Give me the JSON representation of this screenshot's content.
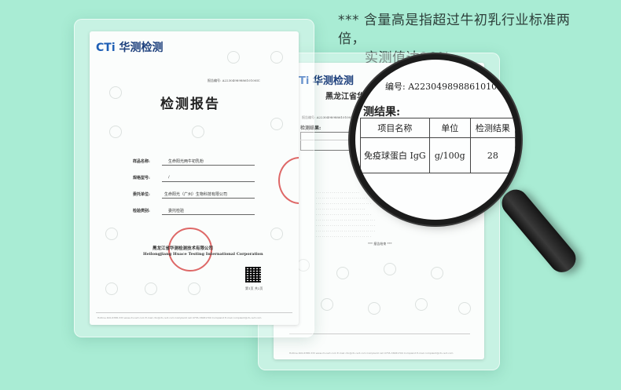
{
  "headline": {
    "line1": "*** 含量高是指超过牛初乳行业标准两倍，",
    "line2": "实测值达28%。"
  },
  "report_front": {
    "logo_mark": "CTi",
    "logo_text": "华测检测",
    "report_no": "报告编号: A2230498988610100IC",
    "title": "检测报告",
    "fields": [
      {
        "label": "样品名称:",
        "value": "生命阳光两牛初乳粉"
      },
      {
        "label": "规格型号:",
        "value": "/"
      },
      {
        "label": "委托单位:",
        "value": "生命阳光（广州）生物科技有限公司"
      },
      {
        "label": "检验类别:",
        "value": "委托检验"
      }
    ],
    "company_cn": "黑龙江省华测检测技术有限公司",
    "company_en": "Heilongjiang Huace Testing International Corporation",
    "page": "第1页 共2页",
    "footer": "Hotline 400-6788-333    www.cti-cert.com    E-mail ctic@cti-cert.com    Complaint call 0755-33681700    Complaint E-mail complaint@cti-cert.com"
  },
  "report_back": {
    "logo_mark": "Ti",
    "logo_text": "华测检测",
    "company_partial": "黑龙江省华",
    "report_no_small": "报告编号: A2230498988610100IC",
    "results_label": "检测结果:",
    "end_text": "*** 报告结束 ***",
    "footer": "Hotline 400-6788-333    www.cti-cert.com    E-mail ctic@cti-cert.com    Complaint call 0755-33681700    Complaint E-mail complaint@cti-cert.com"
  },
  "magnifier": {
    "report_no": "编号: A2230498988610100IC",
    "results_label": "测结果:",
    "table": {
      "headers": [
        "项目名称",
        "单位",
        "检测结果"
      ],
      "row": [
        "免疫球蛋白 IgG",
        "g/100g",
        "28"
      ]
    }
  }
}
